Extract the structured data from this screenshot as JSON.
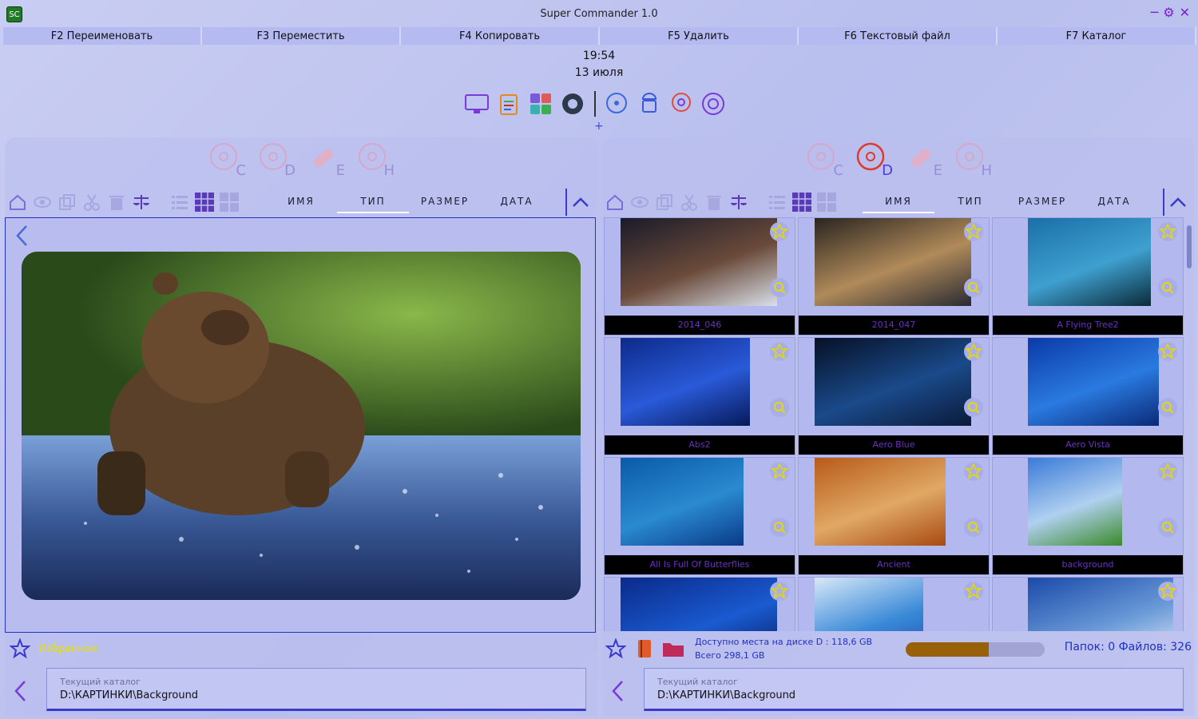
{
  "app": {
    "title": "Super Commander 1.0",
    "logo_text": "SC"
  },
  "fkeys": [
    {
      "label": "F2 Переименовать"
    },
    {
      "label": "F3 Переместить"
    },
    {
      "label": "F4 Копировать"
    },
    {
      "label": "F5 Удалить"
    },
    {
      "label": "F6 Текстовый файл"
    },
    {
      "label": "F7 Каталог"
    }
  ],
  "clock": {
    "time": "19:54",
    "date": "13 июля"
  },
  "toolbar_icons": [
    "monitor-icon",
    "clipboard-icon",
    "calculator-icon",
    "settings-gear-icon",
    "disc-music-icon",
    "android-icon",
    "head-gears-icon",
    "code-gear-icon"
  ],
  "left_panel": {
    "drives": [
      {
        "letter": "C"
      },
      {
        "letter": "D"
      },
      {
        "letter": "E"
      },
      {
        "letter": "H"
      }
    ],
    "active_drive": "none",
    "sort_labels": [
      "ИМЯ",
      "ТИП",
      "РАЗМЕР",
      "ДАТА"
    ],
    "selected_sort": "ТИП",
    "favorites_label": "Избранное",
    "current_dir_label": "Текущий каталог",
    "current_dir": "D:\\КАРТИНКИ\\Background"
  },
  "right_panel": {
    "drives": [
      {
        "letter": "C"
      },
      {
        "letter": "D"
      },
      {
        "letter": "E"
      },
      {
        "letter": "H"
      }
    ],
    "active_drive": "D",
    "sort_labels": [
      "ИМЯ",
      "ТИП",
      "РАЗМЕР",
      "ДАТА"
    ],
    "selected_sort": "ИМЯ",
    "files": [
      {
        "name": "2014_046",
        "colors": [
          "#1a1b2a",
          "#6a4a3a",
          "#d9e0ea"
        ]
      },
      {
        "name": "2014_047",
        "colors": [
          "#2a2520",
          "#b08a5a",
          "#2a2a32"
        ]
      },
      {
        "name": "A Flying Tree2",
        "colors": [
          "#1a6fa8",
          "#3fa0cf",
          "#0b2a3a"
        ]
      },
      {
        "name": "Abs2",
        "colors": [
          "#0c2a8a",
          "#2a5ad8",
          "#061a5a"
        ]
      },
      {
        "name": "Aero Blue",
        "colors": [
          "#061026",
          "#1a4a8a",
          "#0a1a3a"
        ]
      },
      {
        "name": "Aero Vista",
        "colors": [
          "#0a3aa8",
          "#2a7ae0",
          "#0a2a78"
        ]
      },
      {
        "name": "All Is Full Of Butterflies",
        "colors": [
          "#0a5aa8",
          "#2a8ad0",
          "#0a3a88"
        ]
      },
      {
        "name": "Ancient",
        "colors": [
          "#b85a1a",
          "#e0a864",
          "#a84a12"
        ]
      },
      {
        "name": "background",
        "colors": [
          "#3a7ad8",
          "#b0d0f0",
          "#3a8a2a"
        ]
      },
      {
        "name": "",
        "colors": [
          "#0a2a8a",
          "#1a5ad0",
          "#061a5a"
        ]
      },
      {
        "name": "",
        "colors": [
          "#d8e8f8",
          "#3a8ad8",
          "#1a4aa8"
        ]
      },
      {
        "name": "",
        "colors": [
          "#1a4aa8",
          "#6a9ad8",
          "#e8f0f8"
        ]
      }
    ],
    "disk_free": "Доступно места на диске D : 118,6 GB",
    "disk_total": "Всего 298,1 GB",
    "disk_used_fraction": 0.6,
    "counts": "Папок: 0   Файлов: 326",
    "current_dir_label": "Текущий каталог",
    "current_dir": "D:\\КАРТИНКИ\\Background"
  },
  "colors": {
    "accent": "#3a3acb",
    "icon": "#7a6ed8",
    "caption": "#6b2ec0",
    "progress": "#99600a"
  }
}
